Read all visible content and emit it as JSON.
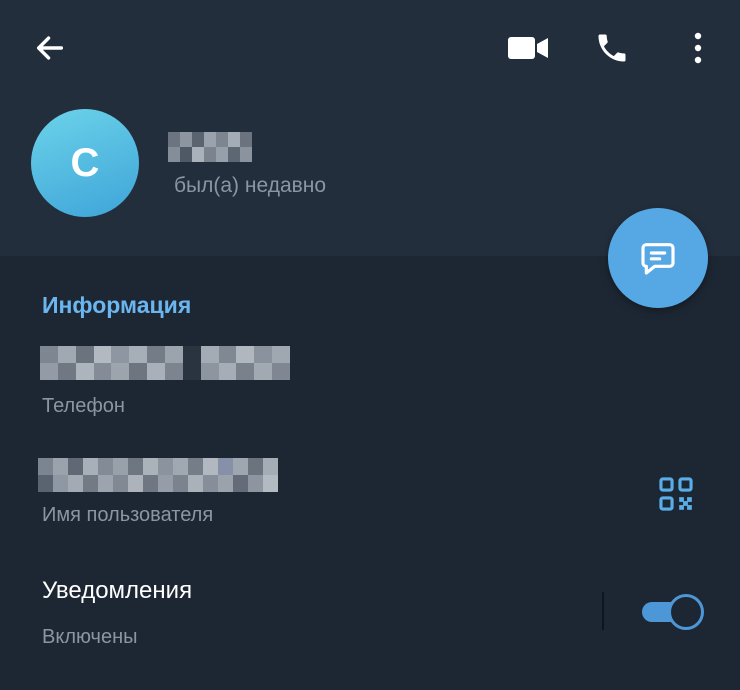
{
  "toolbar": {
    "back_icon": "arrow-left-icon",
    "video_icon": "video-camera-icon",
    "call_icon": "phone-icon",
    "more_icon": "more-vertical-icon"
  },
  "profile": {
    "avatar_letter": "C",
    "status": "был(а) недавно"
  },
  "fab": {
    "icon": "message-icon"
  },
  "info": {
    "section_title": "Информация",
    "phone_label": "Телефон",
    "username_label": "Имя пользователя",
    "qr_icon": "qr-code-icon"
  },
  "notifications": {
    "title": "Уведомления",
    "status": "Включены",
    "enabled": true
  },
  "colors": {
    "background": "#1d2733",
    "header": "#232e3c",
    "accent": "#56a8e4",
    "section_title": "#6cb6f0",
    "secondary_text": "#8a96a3"
  }
}
